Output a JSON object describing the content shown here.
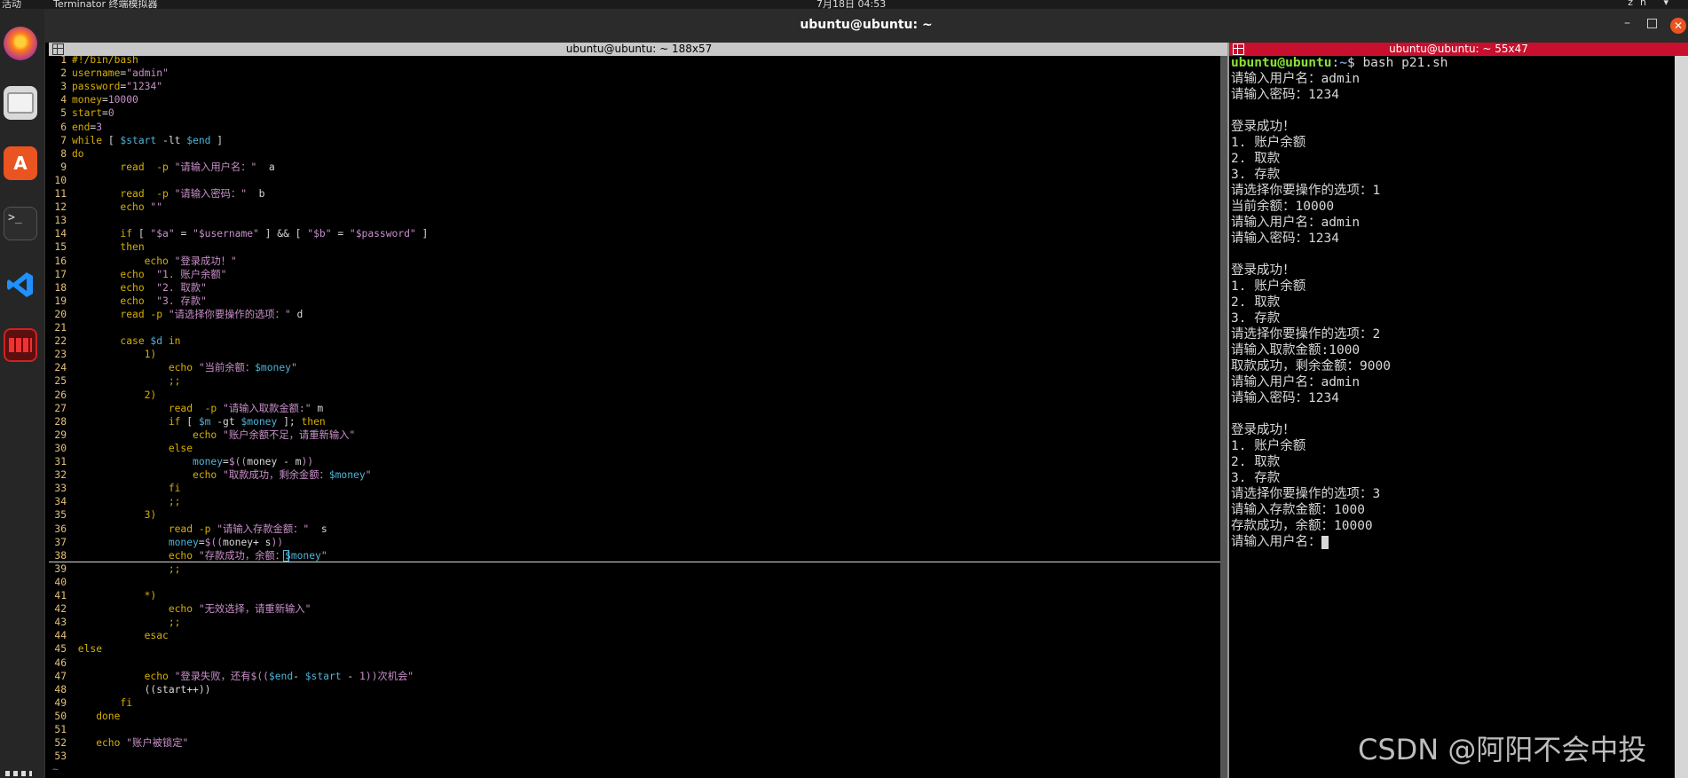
{
  "topbar": {
    "activities": "活动",
    "app": "Terminator 终端模拟器",
    "clock": "7月18日 04:53",
    "system": "zh ▾"
  },
  "dock": {
    "items": [
      "firefox-icon",
      "files-icon",
      "app-center-icon",
      "terminal-icon",
      "vscode-icon",
      "terminator-icon",
      "show-apps-icon"
    ],
    "terminal_glyph": ">_",
    "appcenter_glyph": "A"
  },
  "window": {
    "title": "ubuntu@ubuntu: ~",
    "min": "–",
    "close": "✕"
  },
  "left_pane": {
    "title": "ubuntu@ubuntu: ~ 188x57",
    "tilde": "~",
    "lines": [
      {
        "n": "1",
        "segs": [
          [
            "#!/bin/bash",
            "kw"
          ]
        ]
      },
      {
        "n": "2",
        "segs": [
          [
            "username",
            "kw"
          ],
          [
            "=",
            "default"
          ],
          [
            "\"admin\"",
            "str"
          ]
        ]
      },
      {
        "n": "3",
        "segs": [
          [
            "password",
            "kw"
          ],
          [
            "=",
            "default"
          ],
          [
            "\"1234\"",
            "str"
          ]
        ]
      },
      {
        "n": "4",
        "segs": [
          [
            "money",
            "kw"
          ],
          [
            "=",
            "default"
          ],
          [
            "10000",
            "num"
          ]
        ]
      },
      {
        "n": "5",
        "segs": [
          [
            "start",
            "kw"
          ],
          [
            "=",
            "default"
          ],
          [
            "0",
            "num"
          ]
        ]
      },
      {
        "n": "6",
        "segs": [
          [
            "end",
            "kw"
          ],
          [
            "=",
            "default"
          ],
          [
            "3",
            "num"
          ]
        ]
      },
      {
        "n": "7",
        "segs": [
          [
            "while",
            "kw"
          ],
          [
            " [ ",
            "default"
          ],
          [
            "$start",
            "var"
          ],
          [
            " -lt ",
            "default"
          ],
          [
            "$end",
            "var"
          ],
          [
            " ]",
            "default"
          ]
        ]
      },
      {
        "n": "8",
        "segs": [
          [
            "do",
            "kw"
          ]
        ]
      },
      {
        "n": "9",
        "segs": [
          [
            "        read  -p ",
            "kw"
          ],
          [
            "\"请输入用户名：\"",
            "str"
          ],
          [
            "  a",
            "default"
          ]
        ]
      },
      {
        "n": "10",
        "segs": []
      },
      {
        "n": "11",
        "segs": [
          [
            "        read  -p ",
            "kw"
          ],
          [
            "\"请输入密码：\"",
            "str"
          ],
          [
            "  b",
            "default"
          ]
        ]
      },
      {
        "n": "12",
        "segs": [
          [
            "        echo ",
            "kw"
          ],
          [
            "\"\"",
            "str"
          ]
        ]
      },
      {
        "n": "13",
        "segs": []
      },
      {
        "n": "14",
        "segs": [
          [
            "        if",
            "kw"
          ],
          [
            " [ ",
            "default"
          ],
          [
            "\"$a\"",
            "str"
          ],
          [
            " = ",
            "default"
          ],
          [
            "\"$username\"",
            "str"
          ],
          [
            " ] && [ ",
            "default"
          ],
          [
            "\"$b\"",
            "str"
          ],
          [
            " = ",
            "default"
          ],
          [
            "\"$password\"",
            "str"
          ],
          [
            " ]",
            "default"
          ]
        ]
      },
      {
        "n": "15",
        "segs": [
          [
            "        then",
            "kw"
          ]
        ]
      },
      {
        "n": "16",
        "segs": [
          [
            "            echo ",
            "kw"
          ],
          [
            "\"登录成功！\"",
            "str"
          ]
        ]
      },
      {
        "n": "17",
        "segs": [
          [
            "        echo  ",
            "kw"
          ],
          [
            "\"1. 账户余额\"",
            "str"
          ]
        ]
      },
      {
        "n": "18",
        "segs": [
          [
            "        echo  ",
            "kw"
          ],
          [
            "\"2. 取款\"",
            "str"
          ]
        ]
      },
      {
        "n": "19",
        "segs": [
          [
            "        echo  ",
            "kw"
          ],
          [
            "\"3. 存款\"",
            "str"
          ]
        ]
      },
      {
        "n": "20",
        "segs": [
          [
            "        read -p ",
            "kw"
          ],
          [
            "\"请选择你要操作的选项：\"",
            "str"
          ],
          [
            " d",
            "default"
          ]
        ]
      },
      {
        "n": "21",
        "segs": []
      },
      {
        "n": "22",
        "segs": [
          [
            "        case ",
            "kw"
          ],
          [
            "$d",
            "var"
          ],
          [
            " in",
            "kw"
          ]
        ]
      },
      {
        "n": "23",
        "segs": [
          [
            "            1)",
            "kw"
          ]
        ]
      },
      {
        "n": "24",
        "segs": [
          [
            "                echo ",
            "kw"
          ],
          [
            "\"当前余额：",
            "str"
          ],
          [
            "$money",
            "var"
          ],
          [
            "\"",
            "str"
          ]
        ]
      },
      {
        "n": "25",
        "segs": [
          [
            "                ;;",
            "kw"
          ]
        ]
      },
      {
        "n": "26",
        "segs": [
          [
            "            2)",
            "kw"
          ]
        ]
      },
      {
        "n": "27",
        "segs": [
          [
            "                read  -p ",
            "kw"
          ],
          [
            "\"请输入取款金额:\"",
            "str"
          ],
          [
            " m",
            "default"
          ]
        ]
      },
      {
        "n": "28",
        "segs": [
          [
            "                if",
            "kw"
          ],
          [
            " [ ",
            "default"
          ],
          [
            "$m",
            "var"
          ],
          [
            " -gt ",
            "default"
          ],
          [
            "$money",
            "var"
          ],
          [
            " ]; ",
            "default"
          ],
          [
            "then",
            "kw"
          ]
        ]
      },
      {
        "n": "29",
        "segs": [
          [
            "                    echo ",
            "kw"
          ],
          [
            "\"账户余额不足，请重新输入\"",
            "str"
          ]
        ]
      },
      {
        "n": "30",
        "segs": [
          [
            "                else",
            "kw"
          ]
        ]
      },
      {
        "n": "31",
        "segs": [
          [
            "                    money",
            "var"
          ],
          [
            "=",
            "default"
          ],
          [
            "$((",
            "str"
          ],
          [
            "money - m",
            "default"
          ],
          [
            "))",
            "str"
          ]
        ]
      },
      {
        "n": "32",
        "segs": [
          [
            "                    echo ",
            "kw"
          ],
          [
            "\"取款成功，剩余金额：",
            "str"
          ],
          [
            "$money",
            "var"
          ],
          [
            "\"",
            "str"
          ]
        ]
      },
      {
        "n": "33",
        "segs": [
          [
            "                fi",
            "kw"
          ]
        ]
      },
      {
        "n": "34",
        "segs": [
          [
            "                ;;",
            "kw"
          ]
        ]
      },
      {
        "n": "35",
        "segs": [
          [
            "            3)",
            "kw"
          ]
        ]
      },
      {
        "n": "36",
        "segs": [
          [
            "                read -p ",
            "kw"
          ],
          [
            "\"请输入存款金额：\"",
            "str"
          ],
          [
            "  s",
            "default"
          ]
        ]
      },
      {
        "n": "37",
        "segs": [
          [
            "                money",
            "var"
          ],
          [
            "=",
            "default"
          ],
          [
            "$((",
            "str"
          ],
          [
            "money+ s",
            "default"
          ],
          [
            "))",
            "str"
          ]
        ]
      },
      {
        "n": "38",
        "segs": [
          [
            "                echo ",
            "kw"
          ],
          [
            "\"存款成功，余额：",
            "str"
          ],
          [
            "$money",
            "var"
          ],
          [
            "\"",
            "str"
          ]
        ]
      },
      {
        "n": "39",
        "segs": [
          [
            "                ;;",
            "kw"
          ]
        ]
      },
      {
        "n": "40",
        "segs": []
      },
      {
        "n": "41",
        "segs": [
          [
            "            *)",
            "kw"
          ]
        ]
      },
      {
        "n": "42",
        "segs": [
          [
            "                echo ",
            "kw"
          ],
          [
            "\"无效选择，请重新输入\"",
            "str"
          ]
        ]
      },
      {
        "n": "43",
        "segs": [
          [
            "                ;;",
            "kw"
          ]
        ]
      },
      {
        "n": "44",
        "segs": [
          [
            "            esac",
            "kw"
          ]
        ]
      },
      {
        "n": "45",
        "segs": [
          [
            " else",
            "kw"
          ]
        ]
      },
      {
        "n": "46",
        "segs": []
      },
      {
        "n": "47",
        "segs": [
          [
            "            echo ",
            "kw"
          ],
          [
            "\"登录失败，还有",
            "str"
          ],
          [
            "$((",
            "str"
          ],
          [
            "$end",
            "var"
          ],
          [
            "- ",
            "default"
          ],
          [
            "$start",
            "var"
          ],
          [
            " - ",
            "default"
          ],
          [
            "1",
            "num"
          ],
          [
            "))",
            "str"
          ],
          [
            "次机会\"",
            "str"
          ]
        ]
      },
      {
        "n": "48",
        "segs": [
          [
            "            ((start++))",
            "default"
          ]
        ]
      },
      {
        "n": "49",
        "segs": [
          [
            "        fi",
            "kw"
          ]
        ]
      },
      {
        "n": "50",
        "segs": [
          [
            "    done",
            "kw"
          ]
        ]
      },
      {
        "n": "51",
        "segs": []
      },
      {
        "n": "52",
        "segs": [
          [
            "    echo ",
            "kw"
          ],
          [
            "\"账户被锁定\"",
            "str"
          ]
        ]
      },
      {
        "n": "53",
        "segs": []
      }
    ]
  },
  "right_pane": {
    "title": "ubuntu@ubuntu: ~ 55x47",
    "prompt_user": "ubuntu@ubuntu",
    "prompt_sep": ":",
    "prompt_path": "~",
    "prompt_end": "$ ",
    "command": "bash p21.sh",
    "output": [
      "请输入用户名：admin",
      "请输入密码：1234",
      "",
      "登录成功！",
      "1. 账户余额",
      "2. 取款",
      "3. 存款",
      "请选择你要操作的选项：1",
      "当前余额：10000",
      "请输入用户名：admin",
      "请输入密码：1234",
      "",
      "登录成功！",
      "1. 账户余额",
      "2. 取款",
      "3. 存款",
      "请选择你要操作的选项：2",
      "请输入取款金额:1000",
      "取款成功，剩余金额：9000",
      "请输入用户名：admin",
      "请输入密码：1234",
      "",
      "登录成功！",
      "1. 账户余额",
      "2. 取款",
      "3. 存款",
      "请选择你要操作的选项：3",
      "请输入存款金额：1000",
      "存款成功，余额：10000",
      "请输入用户名："
    ]
  },
  "watermark": "CSDN @阿阳不会中投"
}
